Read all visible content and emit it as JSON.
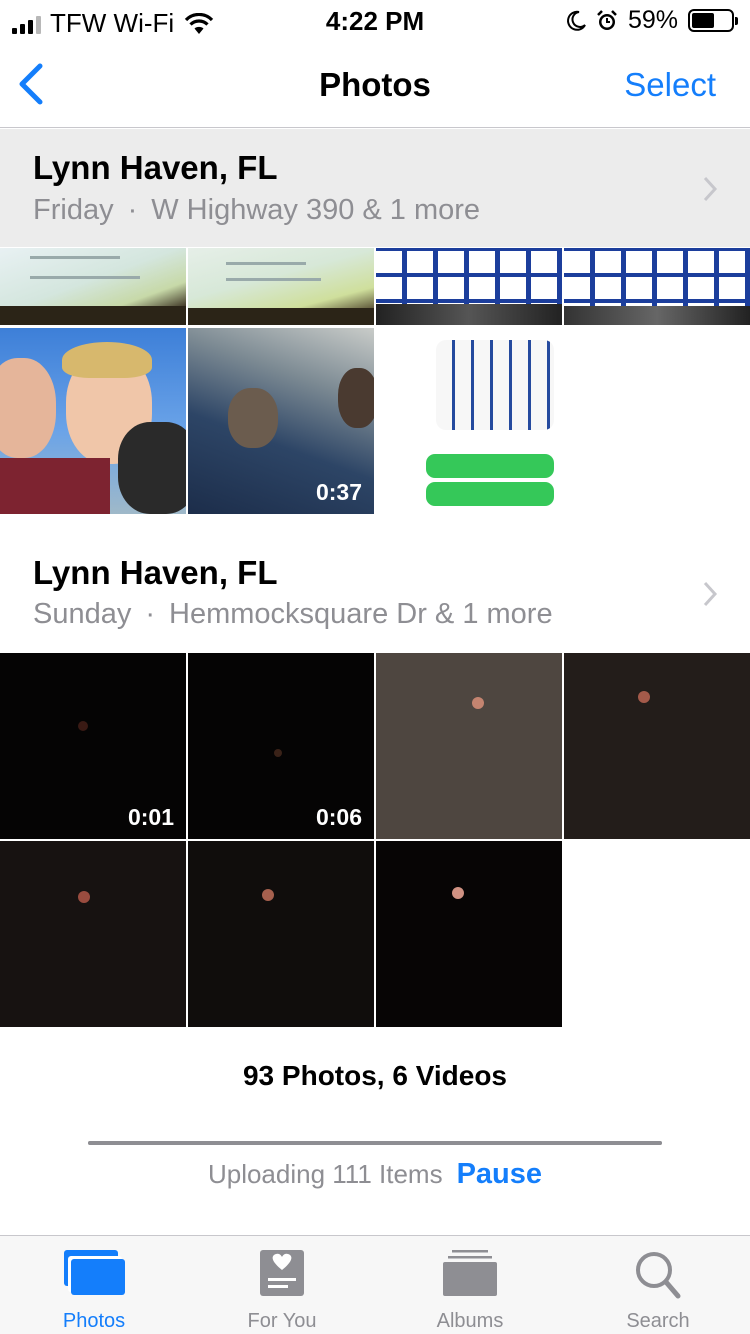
{
  "status_bar": {
    "carrier": "TFW Wi-Fi",
    "time": "4:22 PM",
    "battery_percent": "59%",
    "battery_level": 0.59
  },
  "nav": {
    "title": "Photos",
    "select_label": "Select"
  },
  "moments": [
    {
      "title": "Lynn Haven, FL",
      "day": "Friday",
      "separator": "·",
      "location": "W Highway 390 & 1 more"
    },
    {
      "title": "Lynn Haven, FL",
      "day": "Sunday",
      "separator": "·",
      "location": "Hemmocksquare Dr & 1 more"
    }
  ],
  "thumbnails": {
    "video_1": "0:37",
    "video_2": "0:01",
    "video_3": "0:06"
  },
  "summary": "93 Photos, 6 Videos",
  "upload": {
    "status": "Uploading 111 Items",
    "pause_label": "Pause",
    "progress": 1.0
  },
  "tabs": [
    {
      "label": "Photos",
      "icon": "photos-icon",
      "active": true
    },
    {
      "label": "For You",
      "icon": "for-you-icon",
      "active": false
    },
    {
      "label": "Albums",
      "icon": "albums-icon",
      "active": false
    },
    {
      "label": "Search",
      "icon": "search-icon",
      "active": false
    }
  ],
  "colors": {
    "accent": "#147efb",
    "secondary_text": "#8e8e93"
  }
}
